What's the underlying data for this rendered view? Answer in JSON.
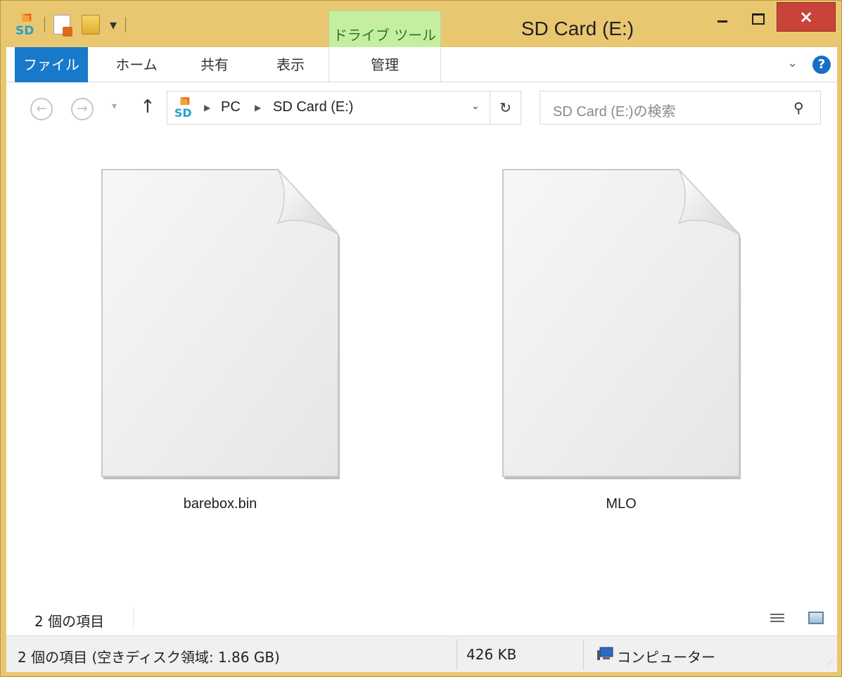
{
  "window": {
    "title": "SD Card (E:)",
    "close_symbol": "×",
    "contextual_tab": "ドライブ ツール"
  },
  "ribbon": {
    "tabs": [
      "ファイル",
      "ホーム",
      "共有",
      "表示",
      "管理"
    ],
    "help_symbol": "?"
  },
  "address": {
    "breadcrumb": [
      "PC",
      "SD Card (E:)"
    ],
    "search_placeholder": "SD Card (E:)の検索"
  },
  "files": [
    {
      "name": "barebox.bin",
      "icon": "blank-file-icon"
    },
    {
      "name": "MLO",
      "icon": "blank-file-icon"
    }
  ],
  "content_status": {
    "item_count": "2 個の項目"
  },
  "statusbar": {
    "summary": "2 個の項目 (空きディスク領域: 1.86 GB)",
    "size": "426 KB",
    "location": "コンピューター"
  },
  "colors": {
    "frame": "#e9c771",
    "file_tab": "#1979ca",
    "close_button": "#c8443a",
    "contextual_tab": "#c6eea1"
  }
}
